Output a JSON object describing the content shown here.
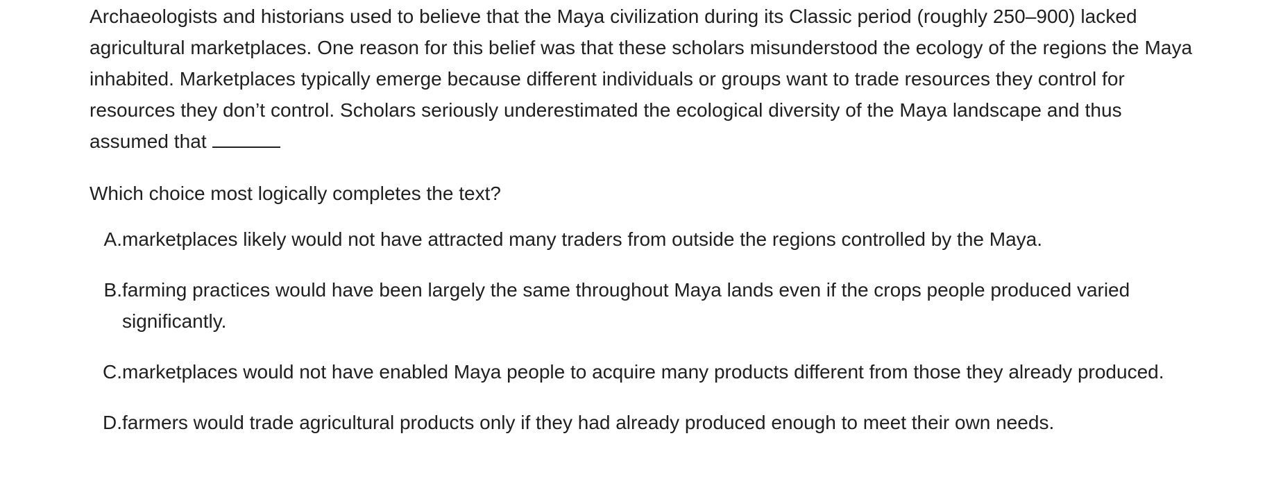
{
  "passage": {
    "text": "Archaeologists and historians used to believe that the Maya civilization during its Classic period (roughly 250–900) lacked agricultural marketplaces. One reason for this belief was that these scholars misunderstood the ecology of the regions the Maya inhabited. Marketplaces typically emerge because different individuals or groups want to trade resources they control for resources they don’t control. Scholars seriously underestimated the ecological diversity of the Maya landscape and thus assumed that"
  },
  "question": {
    "prompt": "Which choice most logically completes the text?"
  },
  "choices": [
    {
      "letter": "A.",
      "text": "marketplaces likely would not have attracted many traders from outside the regions controlled by the Maya."
    },
    {
      "letter": "B.",
      "text": "farming practices would have been largely the same throughout Maya lands even if the crops people produced varied significantly."
    },
    {
      "letter": "C.",
      "text": "marketplaces would not have enabled Maya people to acquire many products different from those they already produced."
    },
    {
      "letter": "D.",
      "text": "farmers would trade agricultural products only if they had already produced enough to meet their own needs."
    }
  ]
}
